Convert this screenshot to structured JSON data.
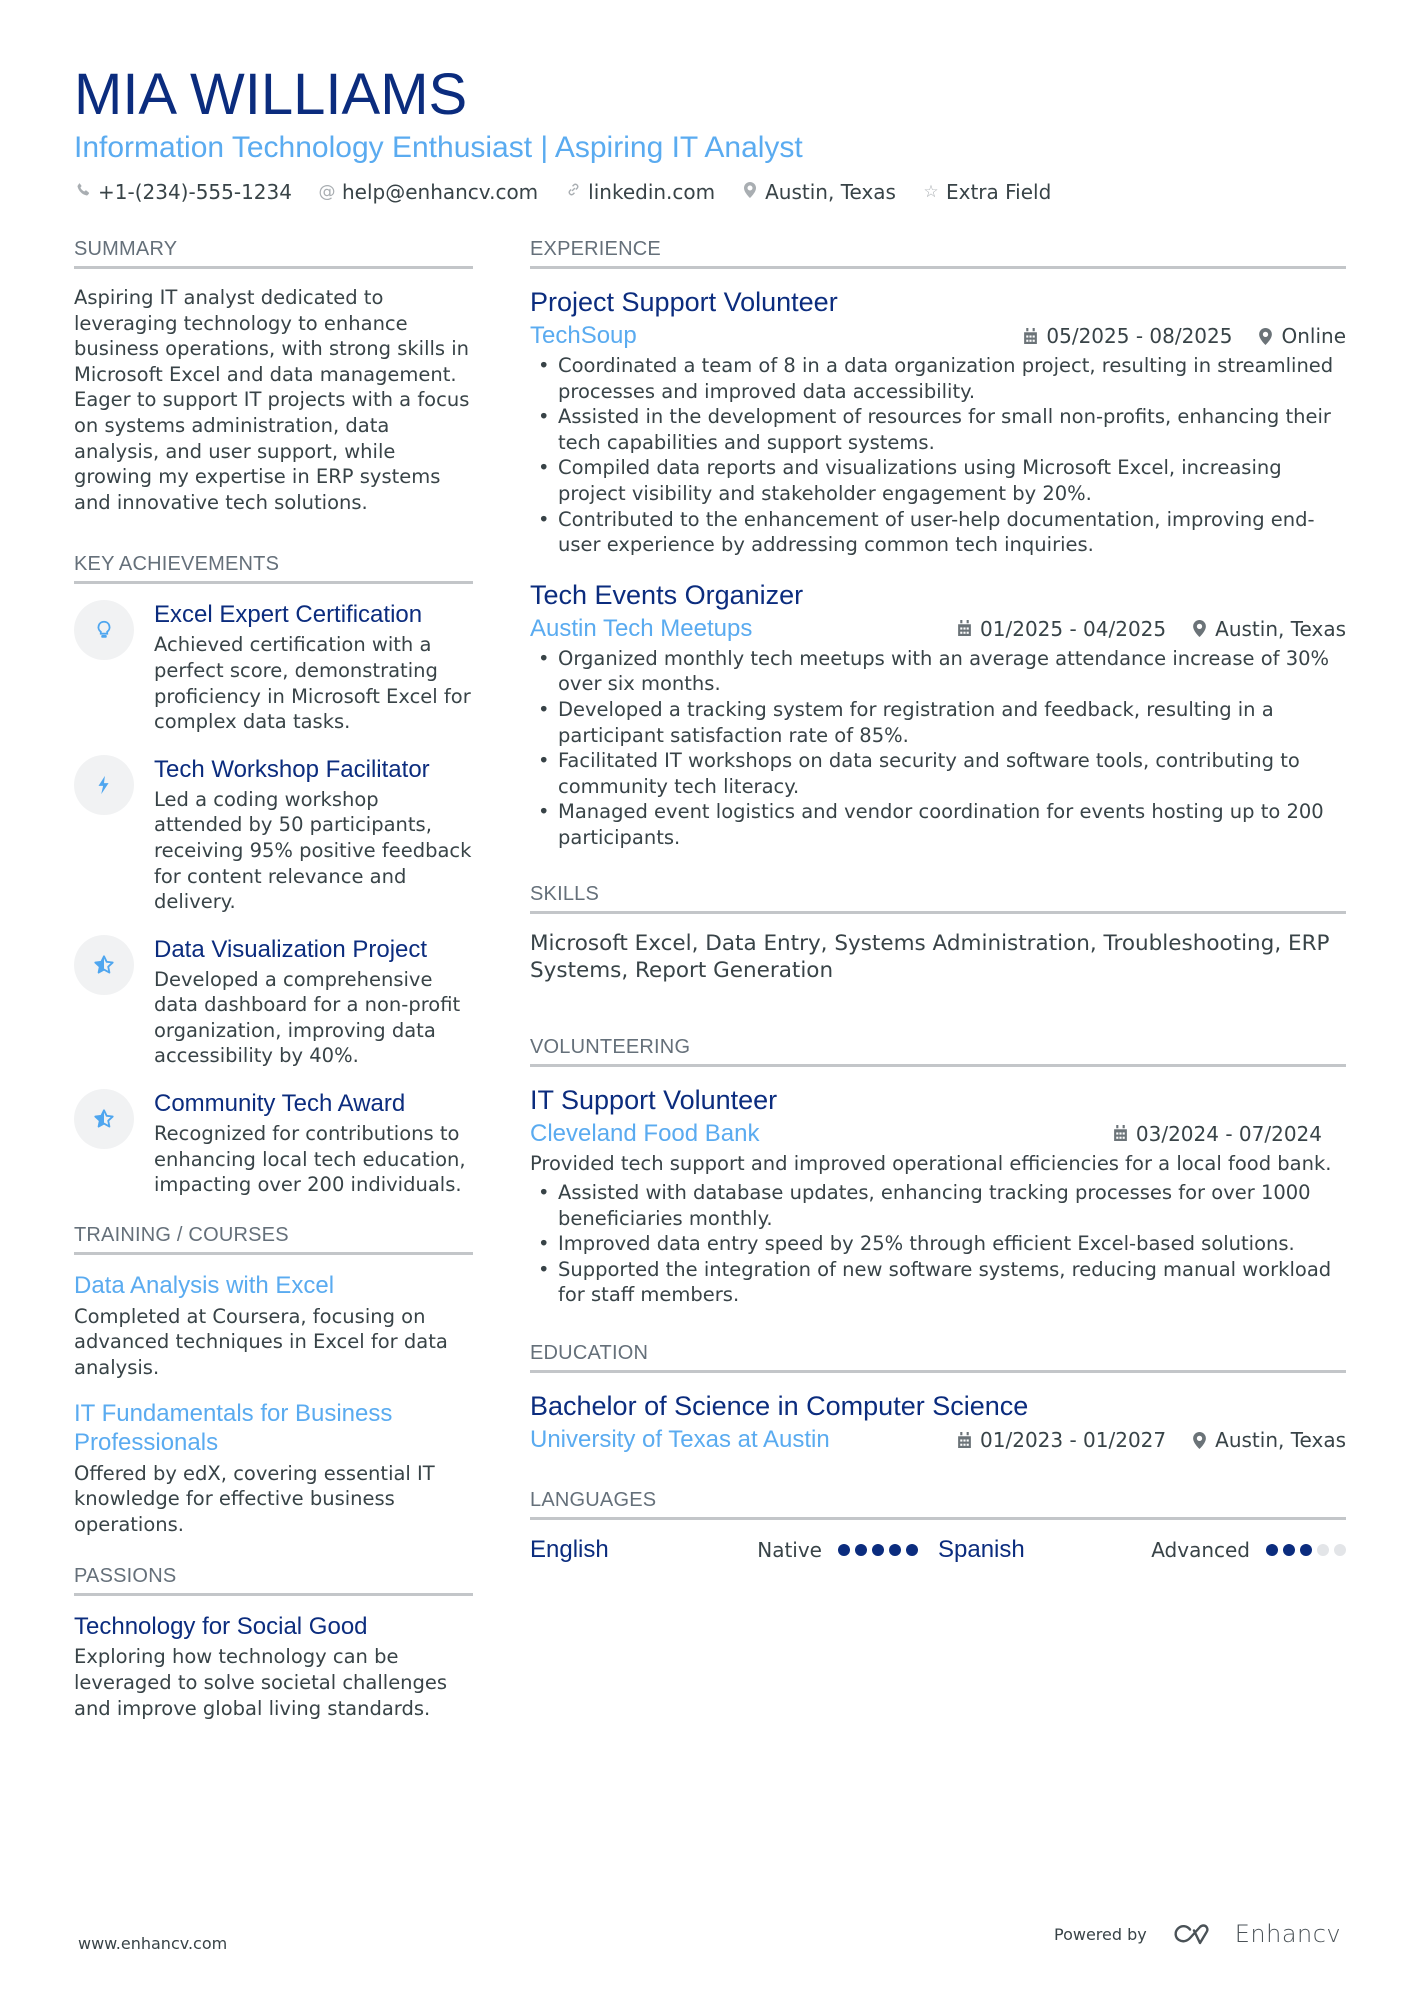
{
  "header": {
    "name": "MIA WILLIAMS",
    "subtitle": "Information Technology Enthusiast | Aspiring IT Analyst",
    "contacts": [
      {
        "icon": "phone-icon",
        "text": "+1-(234)-555-1234"
      },
      {
        "icon": "at-icon",
        "text": "help@enhancv.com"
      },
      {
        "icon": "link-icon",
        "text": "linkedin.com"
      },
      {
        "icon": "location-pin-icon",
        "text": "Austin, Texas"
      },
      {
        "icon": "star-icon",
        "text": "Extra Field"
      }
    ]
  },
  "summary": {
    "title": "SUMMARY",
    "text": "Aspiring IT analyst dedicated to leveraging technology to enhance business operations, with strong skills in Microsoft Excel and data management. Eager to support IT projects with a focus on systems administration, data analysis, and user support, while growing my expertise in ERP systems and innovative tech solutions."
  },
  "achievements": {
    "title": "KEY ACHIEVEMENTS",
    "items": [
      {
        "icon": "lightbulb-icon",
        "title": "Excel Expert Certification",
        "desc": "Achieved certification with a perfect score, demonstrating proficiency in Microsoft Excel for complex data tasks."
      },
      {
        "icon": "lightning-icon",
        "title": "Tech Workshop Facilitator",
        "desc": "Led a coding workshop attended by 50 participants, receiving 95% positive feedback for content relevance and delivery."
      },
      {
        "icon": "star-half-icon",
        "title": "Data Visualization Project",
        "desc": "Developed a comprehensive data dashboard for a non-profit organization, improving data accessibility by 40%."
      },
      {
        "icon": "star-half-icon",
        "title": "Community Tech Award",
        "desc": "Recognized for contributions to enhancing local tech education, impacting over 200 individuals."
      }
    ]
  },
  "training": {
    "title": "TRAINING / COURSES",
    "items": [
      {
        "title": "Data Analysis with Excel",
        "desc": "Completed at Coursera, focusing on advanced techniques in Excel for data analysis."
      },
      {
        "title": "IT Fundamentals for Business Professionals",
        "desc": "Offered by edX, covering essential IT knowledge for effective business operations."
      }
    ]
  },
  "passions": {
    "title": "PASSIONS",
    "items": [
      {
        "title": "Technology for Social Good",
        "desc": "Exploring how technology can be leveraged to solve societal challenges and improve global living standards."
      }
    ]
  },
  "experience": {
    "title": "EXPERIENCE",
    "items": [
      {
        "title": "Project Support Volunteer",
        "company": "TechSoup",
        "dates": "05/2025 - 08/2025",
        "location": "Online",
        "bullets": [
          "Coordinated a team of 8 in a data organization project, resulting in streamlined processes and improved data accessibility.",
          "Assisted in the development of resources for small non-profits, enhancing their tech capabilities and support systems.",
          "Compiled data reports and visualizations using Microsoft Excel, increasing project visibility and stakeholder engagement by 20%.",
          "Contributed to the enhancement of user-help documentation, improving end-user experience by addressing common tech inquiries."
        ]
      },
      {
        "title": "Tech Events Organizer",
        "company": "Austin Tech Meetups",
        "dates": "01/2025 - 04/2025",
        "location": "Austin, Texas",
        "bullets": [
          "Organized monthly tech meetups with an average attendance increase of 30% over six months.",
          "Developed a tracking system for registration and feedback, resulting in a participant satisfaction rate of 85%.",
          "Facilitated IT workshops on data security and software tools, contributing to community tech literacy.",
          "Managed event logistics and vendor coordination for events hosting up to 200 participants."
        ]
      }
    ]
  },
  "skills": {
    "title": "SKILLS",
    "text": "Microsoft Excel, Data Entry, Systems Administration, Troubleshooting, ERP Systems, Report Generation"
  },
  "volunteering": {
    "title": "VOLUNTEERING",
    "items": [
      {
        "title": "IT Support Volunteer",
        "company": "Cleveland Food Bank",
        "dates": "03/2024 - 07/2024",
        "summary": "Provided tech support and improved operational efficiencies for a local food bank.",
        "bullets": [
          "Assisted with database updates, enhancing tracking processes for over 1000 beneficiaries monthly.",
          "Improved data entry speed by 25% through efficient Excel-based solutions.",
          "Supported the integration of new software systems, reducing manual workload for staff members."
        ]
      }
    ]
  },
  "education": {
    "title": "EDUCATION",
    "items": [
      {
        "degree": "Bachelor of Science in Computer Science",
        "school": "University of Texas at Austin",
        "dates": "01/2023 - 01/2027",
        "location": "Austin, Texas"
      }
    ]
  },
  "languages": {
    "title": "LANGUAGES",
    "items": [
      {
        "name": "English",
        "level": "Native",
        "rating": 5,
        "max": 5
      },
      {
        "name": "Spanish",
        "level": "Advanced",
        "rating": 3,
        "max": 5
      }
    ]
  },
  "footer": {
    "website": "www.enhancv.com",
    "powered_by": "Powered by",
    "brand": "Enhancv"
  },
  "colors": {
    "name": "#0b2c7e",
    "accent": "#5aabf0",
    "text": "#384347",
    "rule": "#c3c6c9"
  }
}
